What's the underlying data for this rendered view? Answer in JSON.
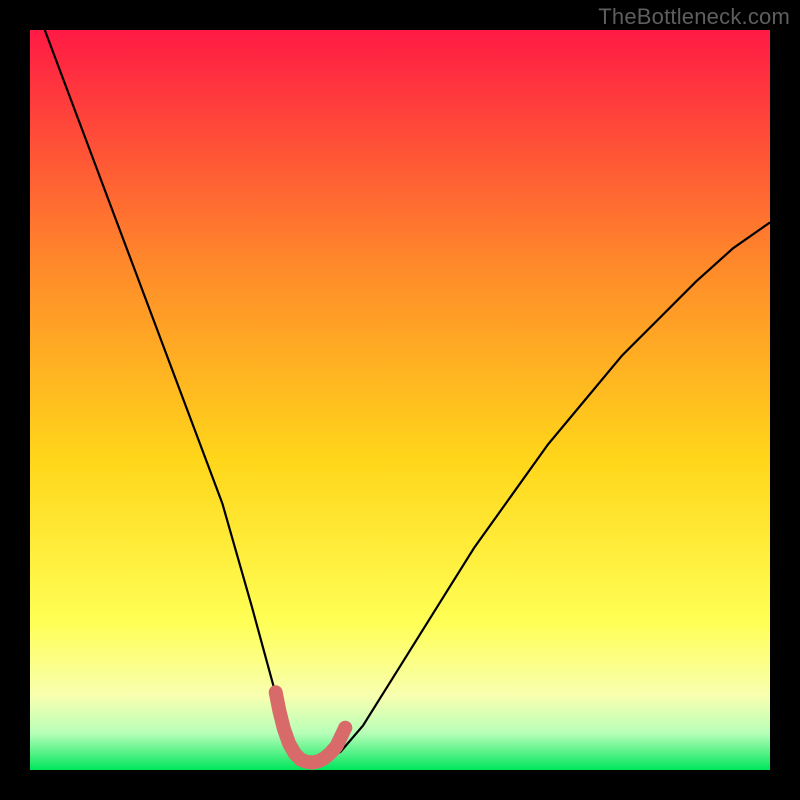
{
  "attribution": "TheBottleneck.com",
  "colors": {
    "background": "#000000",
    "gradient_top": "#ff1a44",
    "gradient_mid_upper": "#ff8a2a",
    "gradient_mid": "#ffd61a",
    "gradient_mid_lower": "#ffff55",
    "gradient_low1": "#f8ffb0",
    "gradient_low2": "#b8ffb8",
    "gradient_bottom": "#00e65c",
    "curve": "#000000",
    "marker_stroke": "#d86a6a",
    "marker_fill": "#d86a6a"
  },
  "chart_data": {
    "type": "line",
    "title": "",
    "xlabel": "",
    "ylabel": "",
    "xlim": [
      0,
      100
    ],
    "ylim": [
      0,
      100
    ],
    "series": [
      {
        "name": "bottleneck-curve",
        "x": [
          2,
          5,
          8,
          11,
          14,
          17,
          20,
          23,
          26,
          28,
          30,
          31.5,
          33,
          34,
          35,
          36,
          37,
          38.5,
          40,
          42,
          45,
          50,
          55,
          60,
          65,
          70,
          75,
          80,
          85,
          90,
          95,
          100
        ],
        "values": [
          100,
          92,
          84,
          76,
          68,
          60,
          52,
          44,
          36,
          29,
          22,
          16.5,
          11,
          7,
          4,
          2.2,
          1.3,
          1.0,
          1.3,
          2.5,
          6,
          14,
          22,
          30,
          37,
          44,
          50,
          56,
          61,
          66,
          70.5,
          74
        ]
      }
    ],
    "markers": {
      "name": "highlight-segment",
      "x": [
        33.2,
        33.7,
        34.3,
        35.0,
        35.8,
        36.6,
        37.4,
        38.2,
        39.0,
        39.8,
        40.6,
        41.4,
        42.6
      ],
      "values": [
        10.5,
        8.0,
        5.6,
        3.6,
        2.2,
        1.4,
        1.1,
        1.0,
        1.2,
        1.6,
        2.3,
        3.2,
        5.7
      ]
    },
    "extra_marker": {
      "x": 42.6,
      "value": 5.7
    }
  }
}
